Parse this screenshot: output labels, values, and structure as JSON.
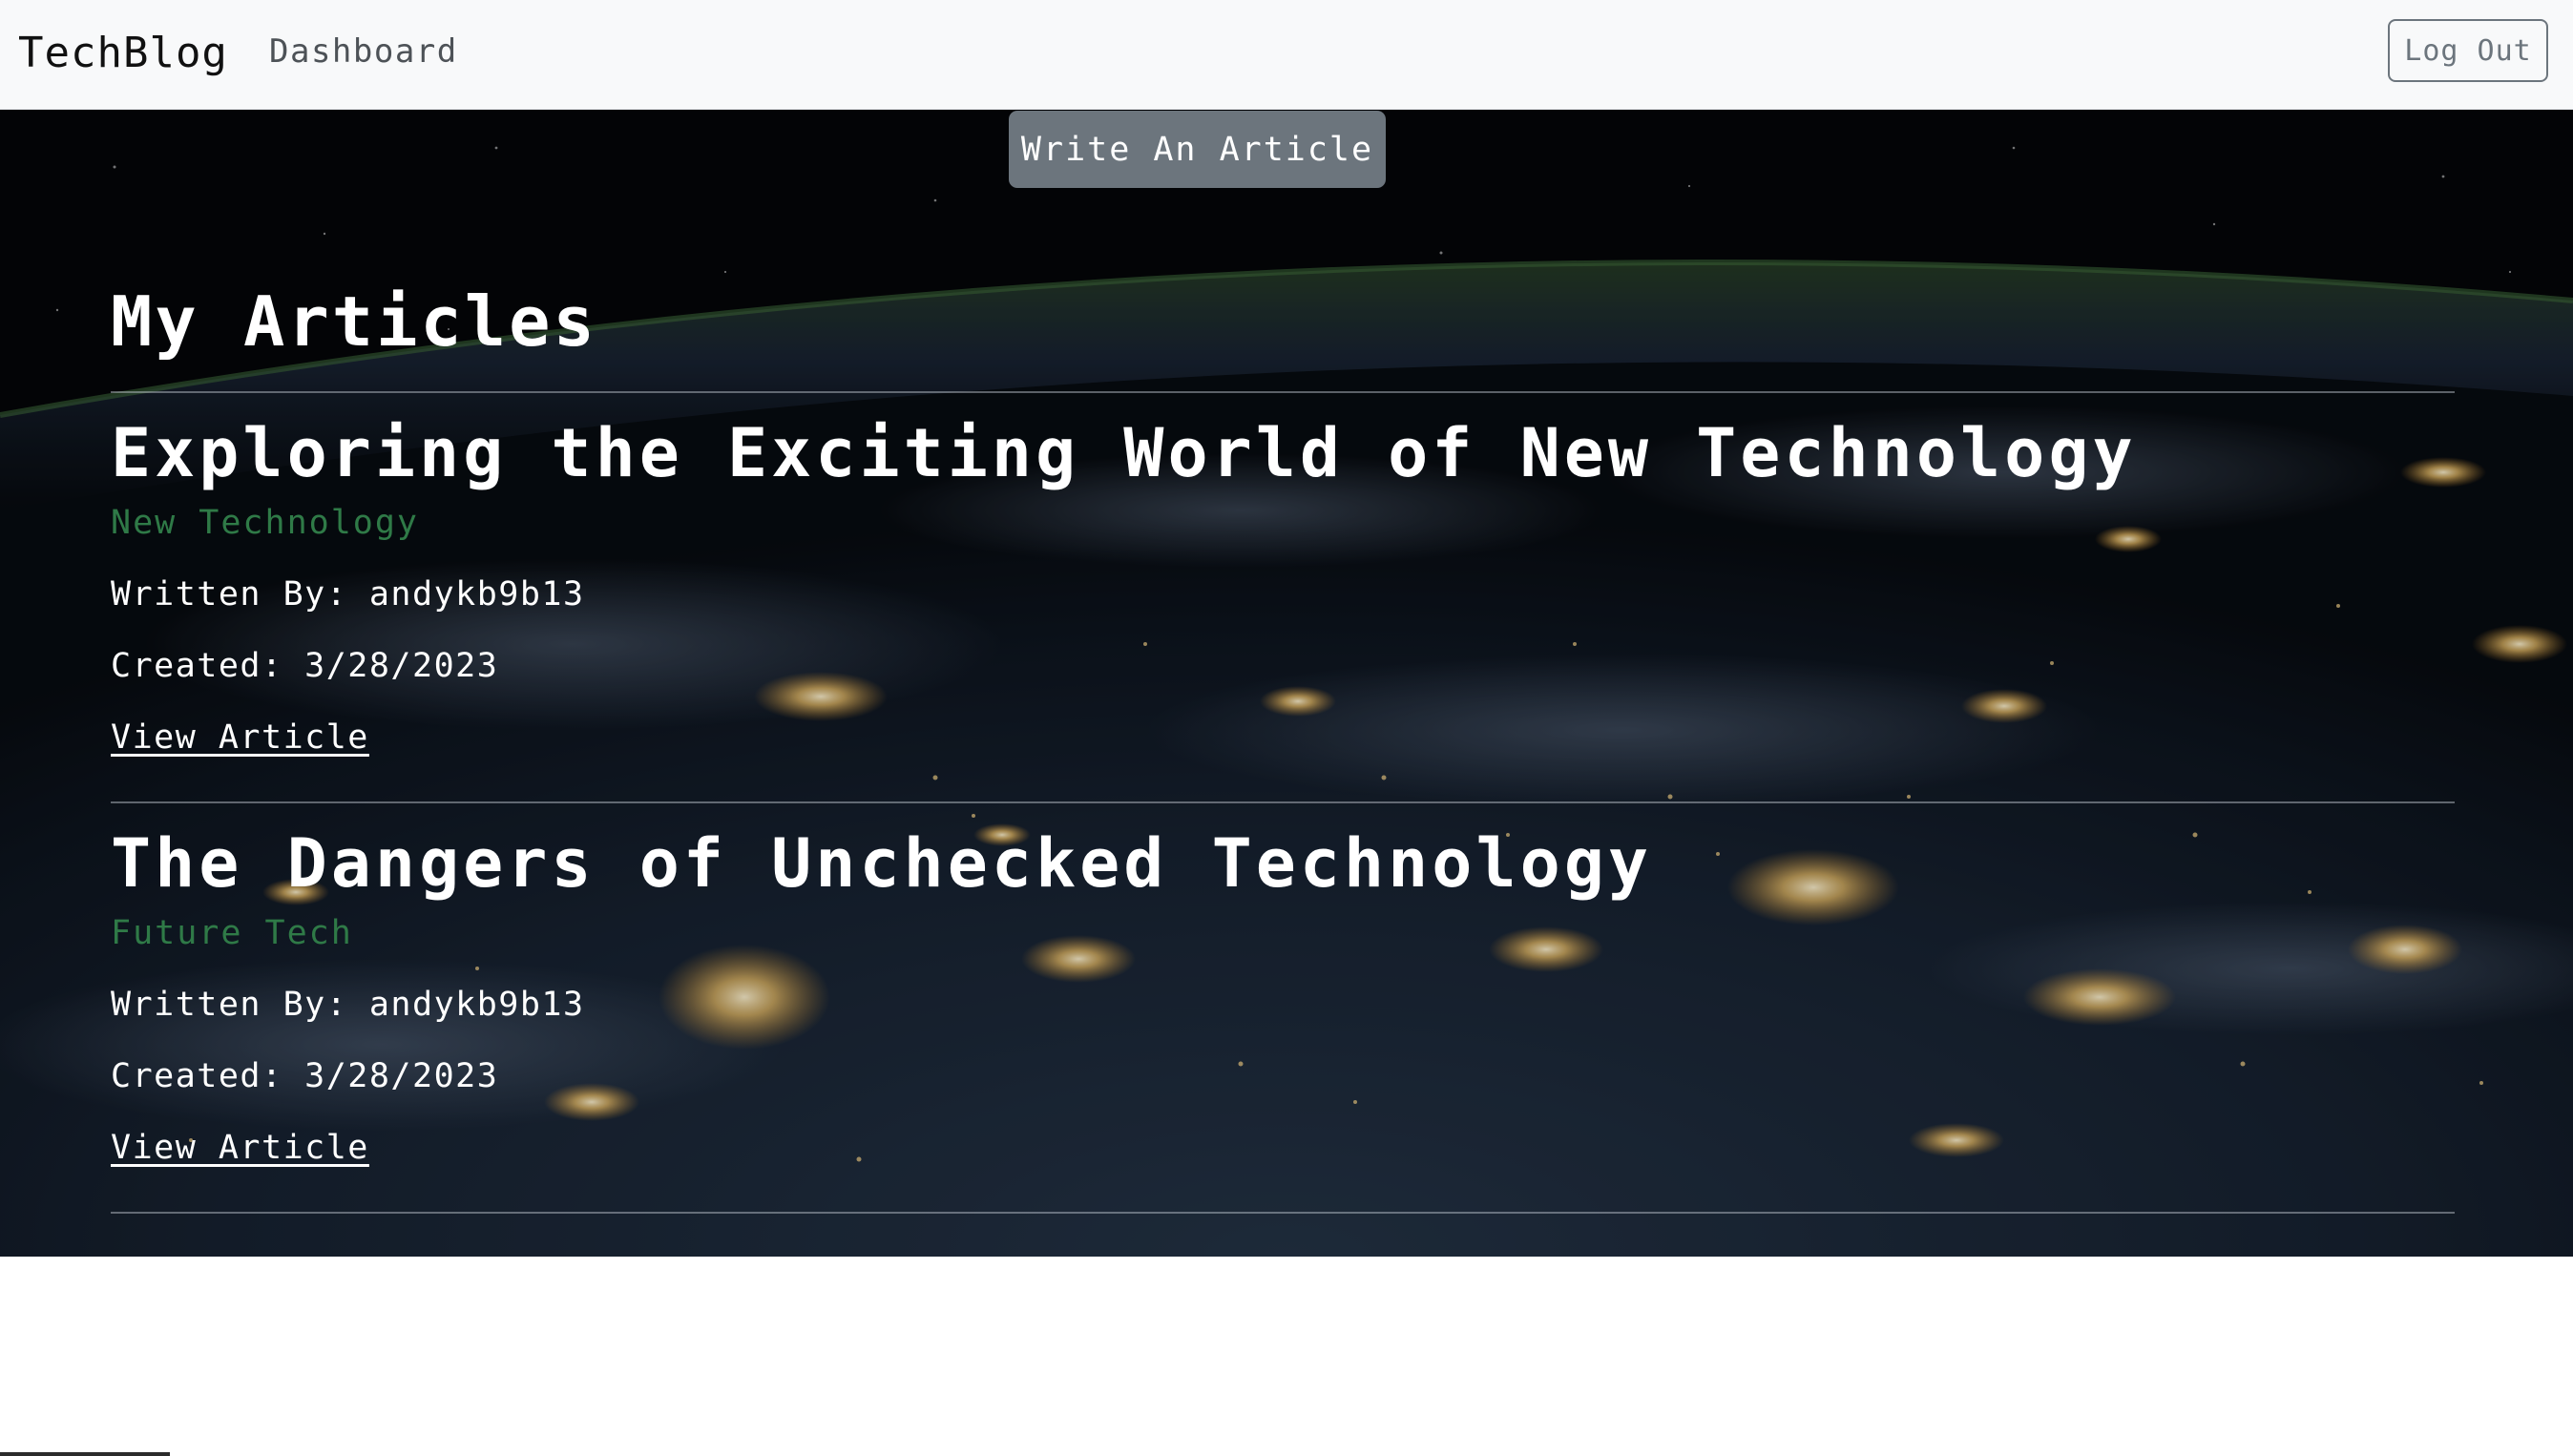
{
  "navbar": {
    "brand": "TechBlog",
    "dashboard_link": "Dashboard",
    "logout_button": "Log Out"
  },
  "actions": {
    "write_article_button": "Write An Article"
  },
  "main": {
    "title": "My Articles",
    "articles": [
      {
        "title": "Exploring the Exciting World of New Technology",
        "category": "New Technology",
        "author": "Written By: andykb9b13",
        "created": "Created: 3/28/2023",
        "link": "View Article"
      },
      {
        "title": "The Dangers of Unchecked Technology",
        "category": "Future Tech",
        "author": "Written By: andykb9b13",
        "created": "Created: 3/28/2023",
        "link": "View Article"
      }
    ]
  },
  "colors": {
    "navbar_bg": "#f8f9fa",
    "button_secondary": "#6c757d",
    "category_text": "#2f7a47",
    "hero_text": "#ffffff"
  }
}
